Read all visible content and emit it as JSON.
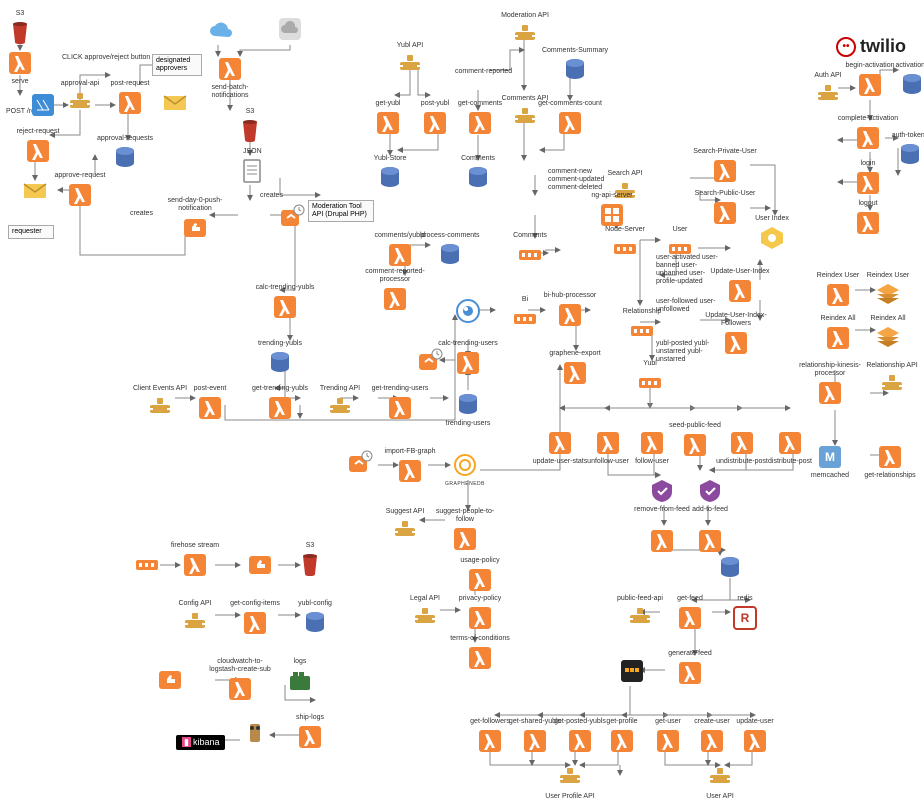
{
  "brand": {
    "label": "twilio"
  },
  "kibana": {
    "label": "kibana"
  },
  "textboxes": {
    "designated": "designated\napprovers",
    "requester": "requester",
    "modtool": "Moderation Tool\nAPI (Drupal PHP)"
  },
  "freetext": {
    "click_approve": "CLICK approve/reject button",
    "post_request_edge": "POST /request",
    "creates1": "creates",
    "creates2": "creates",
    "json": "JSON",
    "comment_events": "comment-new\ncomment-updated\ncomment-deleted",
    "user_events": "user-activated\nuser-banned\nuser-unbanned\nuser-profile-updated",
    "follow_events": "user-followed\nuser-unfollowed",
    "yubl_events": "yubl-posted\nyubl-unstarred\nyubl-unstarred",
    "comment_reported": "comment-reported"
  },
  "nodes": {
    "s3_top": {
      "label": "S3",
      "icon": "s3"
    },
    "serve": {
      "label": "serve",
      "icon": "lambda"
    },
    "cfront": {
      "label": "",
      "icon": "cloudfront"
    },
    "approval_api": {
      "label": "approval-api",
      "icon": "api"
    },
    "post_request": {
      "label": "post-request",
      "icon": "lambda"
    },
    "envelope1": {
      "label": "",
      "icon": "envelope"
    },
    "reject_request": {
      "label": "reject-request",
      "icon": "lambda"
    },
    "approval_requests": {
      "label": "approval-requests",
      "icon": "dynamo"
    },
    "approve_request": {
      "label": "approve-request",
      "icon": "lambda"
    },
    "envelope2": {
      "label": "",
      "icon": "envelope"
    },
    "cloud1": {
      "label": "",
      "icon": "cloud"
    },
    "cloud2": {
      "label": "",
      "icon": "cloudgray"
    },
    "send_batch": {
      "label": "send-batch-notifications",
      "icon": "lambda"
    },
    "s3_mid": {
      "label": "S3",
      "icon": "s3"
    },
    "json_doc": {
      "label": "",
      "icon": "doc"
    },
    "send_day0": {
      "label": "send-day-0-push-notification",
      "icon": "lambda"
    },
    "clock_sns1": {
      "label": "",
      "icon": "snsclock"
    },
    "calc_trending_yubls": {
      "label": "calc-trending-yubls",
      "icon": "lambda"
    },
    "trending_yubls_db": {
      "label": "trending-yubls",
      "icon": "dynamo"
    },
    "yubl_api": {
      "label": "Yubl API",
      "icon": "api"
    },
    "get_yubl": {
      "label": "get-yubl",
      "icon": "lambda"
    },
    "post_yubl": {
      "label": "post-yubl",
      "icon": "lambda"
    },
    "yubl_store": {
      "label": "Yubl-Store",
      "icon": "dynamo"
    },
    "comments_yubld": {
      "label": "comments/yubld",
      "icon": "lambda"
    },
    "process_comments_db": {
      "label": "process-comments",
      "icon": "dynamo"
    },
    "comment_reported_proc": {
      "label": "comment-reported-processor",
      "icon": "lambda"
    },
    "moderation_api": {
      "label": "Moderation API",
      "icon": "api"
    },
    "get_comments": {
      "label": "get-comments",
      "icon": "lambda"
    },
    "comments_api": {
      "label": "Comments API",
      "icon": "api"
    },
    "comments_db": {
      "label": "Comments",
      "icon": "dynamo"
    },
    "comments_kin": {
      "label": "Comments",
      "icon": "kinesis"
    },
    "comments_summary": {
      "label": "Comments-Summary",
      "icon": "dynamo"
    },
    "get_comments_count": {
      "label": "get-comments-count",
      "icon": "lambda"
    },
    "bi_circle": {
      "label": "",
      "icon": "bicircle"
    },
    "bi_kin": {
      "label": "Bi",
      "icon": "kinesis"
    },
    "bi_hub": {
      "label": "bi-hub-processor",
      "icon": "lambda"
    },
    "graphene_export": {
      "label": "graphene-export",
      "icon": "lambda"
    },
    "calc_trending_users": {
      "label": "calc-trending-users",
      "icon": "lambda"
    },
    "clock_sns2": {
      "label": "",
      "icon": "snsclock"
    },
    "trending_users_db": {
      "label": "trending-users",
      "icon": "dynamo"
    },
    "client_events_api": {
      "label": "Client Events API",
      "icon": "api"
    },
    "post_event": {
      "label": "post-event",
      "icon": "lambda"
    },
    "get_trending_yubls": {
      "label": "get-trending-yubls",
      "icon": "lambda"
    },
    "trending_api": {
      "label": "Trending API",
      "icon": "api"
    },
    "get_trending_users": {
      "label": "get-trending-users",
      "icon": "lambda"
    },
    "clock_sns3": {
      "label": "",
      "icon": "snsclock"
    },
    "import_fb": {
      "label": "import-FB-graph",
      "icon": "lambda"
    },
    "graphene_logo": {
      "label": "GRAPHENEDB",
      "icon": "graphene"
    },
    "suggest_api": {
      "label": "Suggest API",
      "icon": "api"
    },
    "suggest_people": {
      "label": "suggest-people-to-follow",
      "icon": "lambda"
    },
    "firehose_kin": {
      "label": "",
      "icon": "kinesis"
    },
    "firehose_lambda": {
      "label": "firehose stream",
      "icon": "lambda"
    },
    "firehose_sns": {
      "label": "",
      "icon": "snslike"
    },
    "firehose_s3": {
      "label": "S3",
      "icon": "s3"
    },
    "config_api": {
      "label": "Config API",
      "icon": "api"
    },
    "get_config": {
      "label": "get-config-items",
      "icon": "lambda"
    },
    "yubl_config": {
      "label": "yubl-config",
      "icon": "dynamo"
    },
    "cw_logstash": {
      "label": "cloudwatch-to-logstash-create-sub",
      "icon": "lambda"
    },
    "cw_sns": {
      "label": "",
      "icon": "snslike"
    },
    "logs_docker": {
      "label": "logs",
      "icon": "docker"
    },
    "ship_logs": {
      "label": "ship-logs",
      "icon": "lambda"
    },
    "logstash": {
      "label": "",
      "icon": "logstash"
    },
    "search_api": {
      "label": "Search API",
      "icon": "api"
    },
    "ng_api_server": {
      "label": "ng-api-server",
      "icon": "ecs"
    },
    "node_server": {
      "label": "Node-Server",
      "icon": "kinesis"
    },
    "user_kin": {
      "label": "User",
      "icon": "kinesis"
    },
    "relationship_kin": {
      "label": "Relationship",
      "icon": "kinesis"
    },
    "yubl_kin": {
      "label": "Yubl",
      "icon": "kinesis"
    },
    "search_private": {
      "label": "Search-Private-User",
      "icon": "lambda"
    },
    "search_public": {
      "label": "Search-Public-User",
      "icon": "lambda"
    },
    "user_index_es": {
      "label": "User Index",
      "icon": "es"
    },
    "update_user_index": {
      "label": "Update-User-Index",
      "icon": "lambda"
    },
    "update_user_followers": {
      "label": "Update-User-Index-Followers",
      "icon": "lambda"
    },
    "auth_api": {
      "label": "Auth API",
      "icon": "api"
    },
    "begin_activation": {
      "label": "begin-activation",
      "icon": "lambda"
    },
    "activations_db": {
      "label": "activations",
      "icon": "dynamo"
    },
    "complete_activation": {
      "label": "complete-activation",
      "icon": "lambda"
    },
    "login": {
      "label": "login",
      "icon": "lambda"
    },
    "auth_tokens": {
      "label": "auth-tokens",
      "icon": "dynamo"
    },
    "logout": {
      "label": "logout",
      "icon": "lambda"
    },
    "reindex_user": {
      "label": "Reindex User",
      "icon": "lambda"
    },
    "reindex_user_aur": {
      "label": "Reindex User",
      "icon": "aurora"
    },
    "reindex_all": {
      "label": "Reindex All",
      "icon": "lambda"
    },
    "reindex_all_aur": {
      "label": "Reindex All",
      "icon": "aurora"
    },
    "rel_kinesis_proc": {
      "label": "relationship-kinesis-processor",
      "icon": "lambda"
    },
    "relationship_api": {
      "label": "Relationship API",
      "icon": "api"
    },
    "memcached": {
      "label": "memcached",
      "icon": "ml"
    },
    "get_relationships": {
      "label": "get-relationships",
      "icon": "lambda"
    },
    "update_user_stats": {
      "label": "update-user-stats",
      "icon": "lambda"
    },
    "unfollow_user": {
      "label": "unfollow-user",
      "icon": "lambda"
    },
    "follow_user": {
      "label": "follow-user",
      "icon": "lambda"
    },
    "seed_public": {
      "label": "seed-public-feed",
      "icon": "lambda"
    },
    "undistribute": {
      "label": "undistribute-post",
      "icon": "lambda"
    },
    "distribute": {
      "label": "distribute-post",
      "icon": "lambda"
    },
    "remove_from_feed": {
      "label": "remove-from-feed",
      "icon": "cf"
    },
    "add_to_feed": {
      "label": "add-to-feed",
      "icon": "cf"
    },
    "remove_lambda": {
      "label": "",
      "icon": "lambda"
    },
    "add_lambda": {
      "label": "",
      "icon": "lambda"
    },
    "feed_db": {
      "label": "",
      "icon": "dynamo"
    },
    "legal_api": {
      "label": "Legal API",
      "icon": "api"
    },
    "usage_policy": {
      "label": "usage-policy",
      "icon": "lambda"
    },
    "privacy_policy": {
      "label": "privacy-policy",
      "icon": "lambda"
    },
    "terms": {
      "label": "terms-of-conditions",
      "icon": "lambda"
    },
    "public_feed_api": {
      "label": "public-feed-api",
      "icon": "api"
    },
    "get_feed": {
      "label": "get-feed",
      "icon": "lambda"
    },
    "redis": {
      "label": "redis",
      "icon": "redis"
    },
    "generate_feed": {
      "label": "generate-feed",
      "icon": "lambda"
    },
    "docker_gen": {
      "label": "",
      "icon": "dockerdark"
    },
    "get_followers": {
      "label": "get-followers",
      "icon": "lambda"
    },
    "get_shared": {
      "label": "get-shared-yubls",
      "icon": "lambda"
    },
    "get_posted": {
      "label": "get-posted-yubls",
      "icon": "lambda"
    },
    "get_profile": {
      "label": "get-profile",
      "icon": "lambda"
    },
    "get_user": {
      "label": "get-user",
      "icon": "lambda"
    },
    "create_user": {
      "label": "create-user",
      "icon": "lambda"
    },
    "update_user": {
      "label": "update-user",
      "icon": "lambda"
    },
    "get_profile2": {
      "label": "get-profile",
      "icon": "lambda"
    },
    "user_profile_api": {
      "label": "User Profile API",
      "icon": "api"
    },
    "user_api": {
      "label": "User API",
      "icon": "api"
    }
  }
}
